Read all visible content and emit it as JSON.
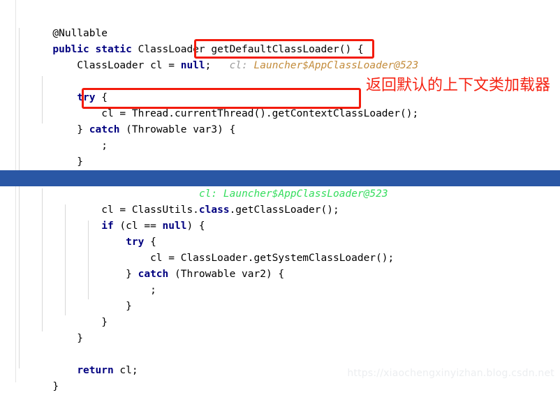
{
  "editor": {
    "language": "java",
    "theme": "light",
    "gutter_icon": "lightbulb-icon",
    "current_line_index": 10,
    "colors": {
      "background": "#ffffff",
      "keyword": "#000080",
      "text": "#000000",
      "current_line_bg": "#2a57a5",
      "inline_hint_label": "#9a9a9a",
      "inline_hint_value": "#c38b3a",
      "inline_hint_on_highlight": "#33dd5c",
      "annotation_red": "#f52313",
      "box_red": "#f31b0c",
      "indent_guide": "#d8d8d8",
      "watermark": "#eceef0"
    },
    "lines": [
      {
        "indent": 1,
        "code": "@Nullable"
      },
      {
        "indent": 0,
        "code": "public static ClassLoader getDefaultClassLoader() {"
      },
      {
        "indent": 1,
        "code": "ClassLoader cl = null;"
      },
      {
        "indent": 0,
        "code": ""
      },
      {
        "indent": 1,
        "code": "try {"
      },
      {
        "indent": 2,
        "code": "cl = Thread.currentThread().getContextClassLoader();"
      },
      {
        "indent": 1,
        "code": "} catch (Throwable var3) {"
      },
      {
        "indent": 2,
        "code": ";"
      },
      {
        "indent": 1,
        "code": "}"
      },
      {
        "indent": 0,
        "code": ""
      },
      {
        "indent": 1,
        "code": "if (cl == null) {"
      },
      {
        "indent": 2,
        "code": "cl = ClassUtils.class.getClassLoader();"
      },
      {
        "indent": 2,
        "code": "if (cl == null) {"
      },
      {
        "indent": 3,
        "code": "try {"
      },
      {
        "indent": 4,
        "code": "cl = ClassLoader.getSystemClassLoader();"
      },
      {
        "indent": 3,
        "code": "} catch (Throwable var2) {"
      },
      {
        "indent": 4,
        "code": ";"
      },
      {
        "indent": 3,
        "code": "}"
      },
      {
        "indent": 2,
        "code": "}"
      },
      {
        "indent": 1,
        "code": "}"
      },
      {
        "indent": 0,
        "code": ""
      },
      {
        "indent": 1,
        "code": "return cl;"
      },
      {
        "indent": 0,
        "code": "}"
      }
    ],
    "inline_hints": [
      {
        "label": "cl:",
        "value": "Launcher$AppClassLoader@523",
        "on_line": 2
      },
      {
        "label": "cl:",
        "value": "Launcher$AppClassLoader@523",
        "on_line": 10
      }
    ]
  },
  "annotations": {
    "chinese_note": "返回默认的上下文类加载器",
    "boxes": [
      {
        "name": "hint-value-box",
        "target": "Launcher$AppClassLoader@523"
      },
      {
        "name": "context-classloader-box",
        "target": "Thread.currentThread().getContextClassLoader();"
      }
    ]
  },
  "watermark": {
    "text": "https://xiaochengxinyizhan.blog.csdn.net"
  }
}
